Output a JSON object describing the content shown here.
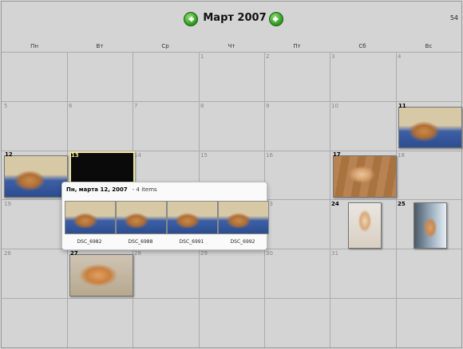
{
  "header": {
    "month_title": "Март 2007",
    "week_number": "54"
  },
  "weekdays": [
    "Пн",
    "Вт",
    "Ср",
    "Чт",
    "Пт",
    "Сб",
    "Вс"
  ],
  "days": {
    "d1": "1",
    "d2": "2",
    "d3": "3",
    "d4": "4",
    "d5": "5",
    "d6": "6",
    "d7": "7",
    "d8": "8",
    "d9": "9",
    "d10": "10",
    "d11": "11",
    "d12": "12",
    "d13": "13",
    "d14": "14",
    "d15": "15",
    "d16": "16",
    "d17": "17",
    "d18": "18",
    "d19": "19",
    "d23": "23",
    "d24": "24",
    "d25": "25",
    "d26": "26",
    "d27": "27",
    "d28": "28",
    "d29": "29",
    "d30": "30",
    "d31": "31"
  },
  "popup": {
    "title": "Пн, марта 12, 2007",
    "count": "- 4 items",
    "items": [
      "DSC_6982",
      "DSC_6988",
      "DSC_6991",
      "DSC_6992"
    ]
  },
  "colors": {
    "background": "#d4d4d4",
    "grid": "#ababab",
    "nav_green": "#3aa62a",
    "selected_border": "#f2e6a0"
  },
  "icons": {
    "prev": "arrow-left-icon",
    "next": "arrow-right-icon"
  }
}
